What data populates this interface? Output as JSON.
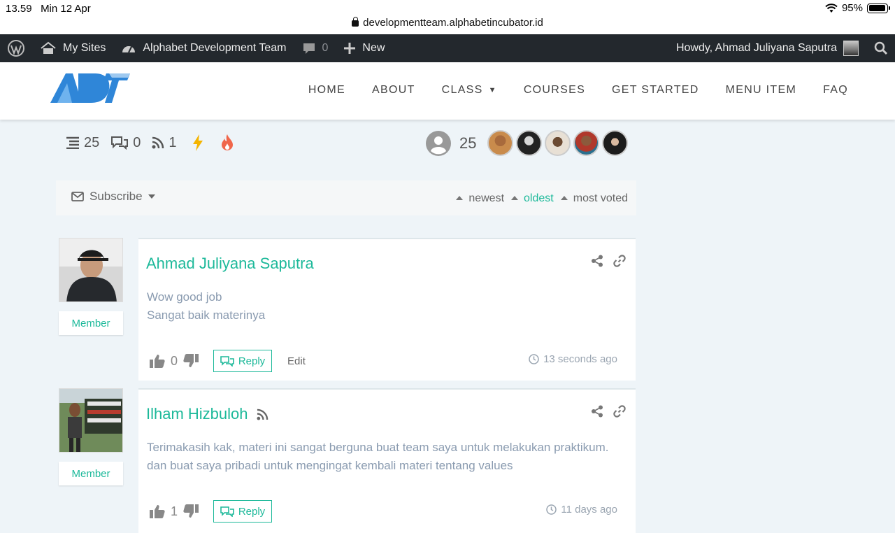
{
  "status_bar": {
    "time": "13.59",
    "date": "Min 12 Apr",
    "battery": "95%",
    "url": "developmentteam.alphabetincubator.id"
  },
  "admin_bar": {
    "my_sites": "My Sites",
    "site_name": "Alphabet Development Team",
    "comments_count": "0",
    "new_label": "New",
    "howdy": "Howdy, Ahmad Juliyana Saputra"
  },
  "nav": {
    "items": [
      "HOME",
      "ABOUT",
      "CLASS",
      "COURSES",
      "GET STARTED",
      "MENU ITEM",
      "FAQ"
    ]
  },
  "stats": {
    "threads": "25",
    "replies": "0",
    "followers": "1",
    "users": "25"
  },
  "subscribe": {
    "label": "Subscribe",
    "sort_newest": "newest",
    "sort_oldest": "oldest",
    "sort_most_voted": "most voted"
  },
  "comments": [
    {
      "author": "Ahmad Juliyana Saputra",
      "role": "Member",
      "lines": [
        "Wow good job",
        "Sangat baik materinya"
      ],
      "votes": "0",
      "reply_label": "Reply",
      "edit_label": "Edit",
      "time": "13 seconds ago"
    },
    {
      "author": "Ilham Hizbuloh",
      "role": "Member",
      "lines": [
        "Terimakasih kak, materi ini sangat berguna buat team saya untuk melakukan praktikum.",
        "dan buat saya pribadi untuk mengingat kembali materi tentang values"
      ],
      "votes": "1",
      "reply_label": "Reply",
      "time": "11 days ago"
    }
  ],
  "colors": {
    "accent": "#1db99a",
    "admin_bar": "#23282d",
    "logo_blue": "#2f86d8"
  }
}
